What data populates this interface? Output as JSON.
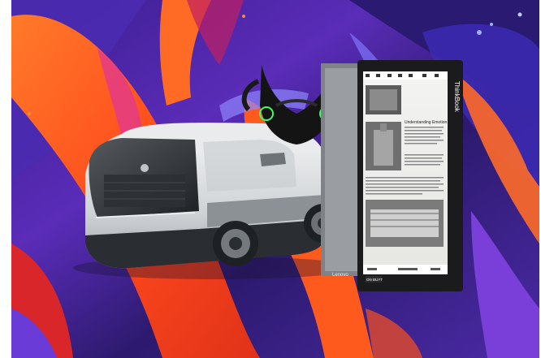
{
  "brand": {
    "monitor_side": "ThinkBook",
    "monitor_front": "Lenovo",
    "monitor_badge": "ON BUYT"
  },
  "ereader": {
    "heading": "Understanding Emotion"
  },
  "colors": {
    "paint_orange": "#ff5a1e",
    "paint_purple": "#6a3bd6",
    "paint_red": "#d8262b",
    "mask_glow": "#39ff6a",
    "vehicle_body": "#d9dcdf",
    "monitor_bezel": "#1b1b1d"
  },
  "objects": [
    {
      "name": "concept-van",
      "icon": "autonomous-shuttle"
    },
    {
      "name": "smart-mask",
      "icon": "led-face-mask"
    },
    {
      "name": "rotated-monitor",
      "icon": "portrait-display"
    }
  ]
}
